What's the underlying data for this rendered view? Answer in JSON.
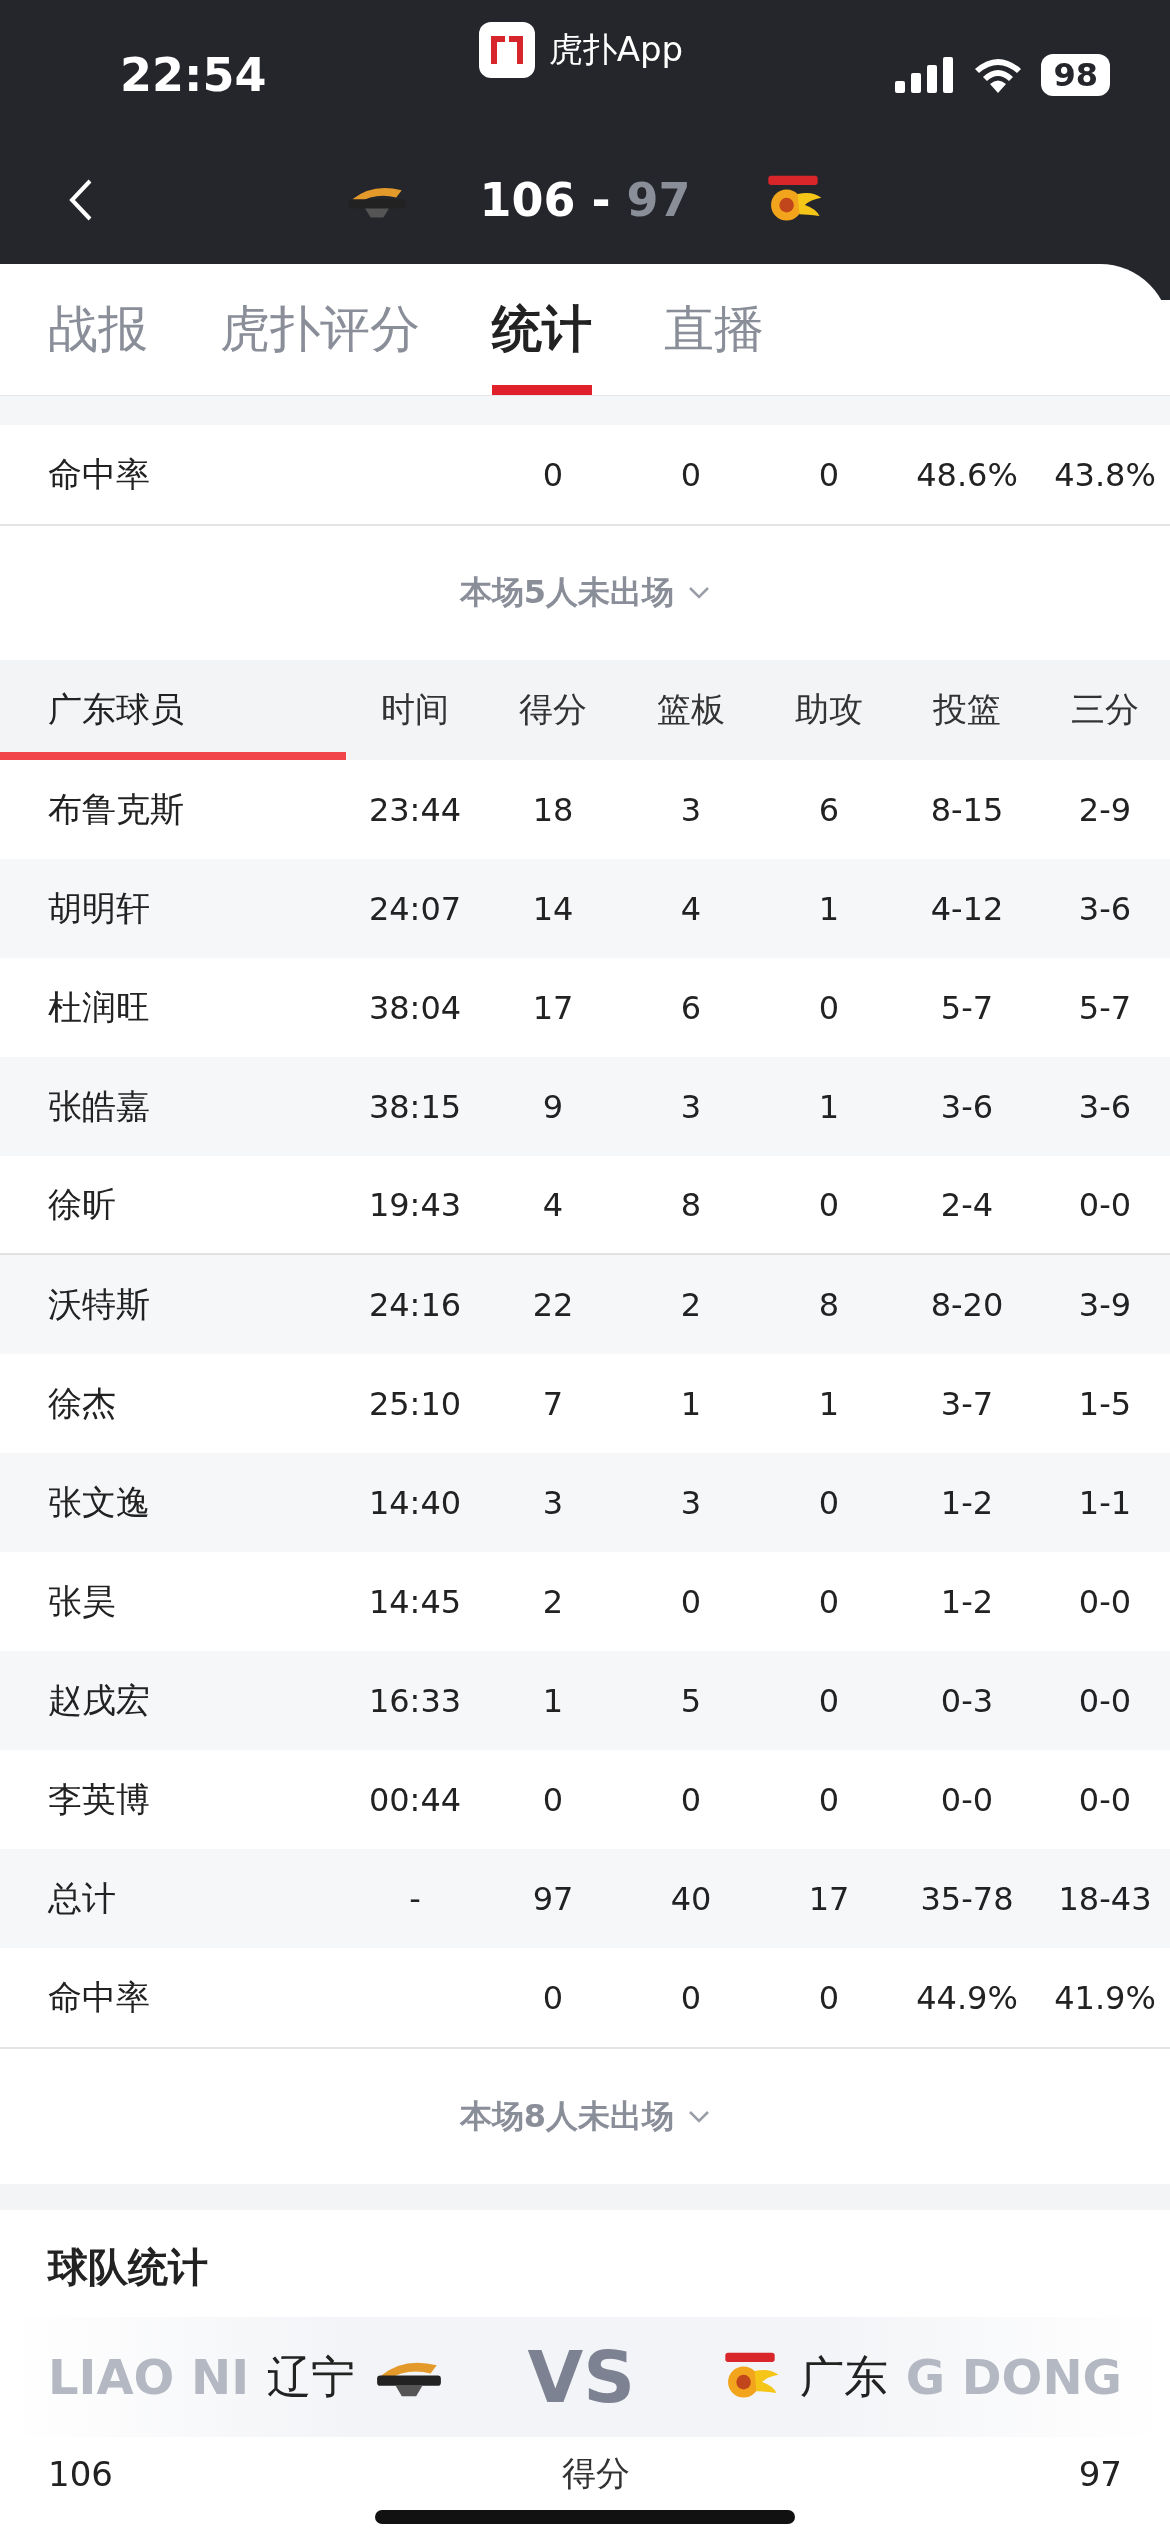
{
  "status_bar": {
    "time": "22:54",
    "back_app": "虎扑App",
    "battery": "98"
  },
  "header": {
    "home_score": "106",
    "separator": "-",
    "away_score": "97"
  },
  "tabs": [
    {
      "label": "战报",
      "selected": false
    },
    {
      "label": "虎扑评分",
      "selected": false
    },
    {
      "label": "统计",
      "selected": true
    },
    {
      "label": "直播",
      "selected": false
    }
  ],
  "prev_table": {
    "rows": [
      {
        "name": "命中率",
        "stats": [
          "0",
          "0",
          "0",
          "48.6%",
          "43.8%"
        ]
      }
    ],
    "footer": "本场5人未出场"
  },
  "table": {
    "columns": [
      "广东球员",
      "时间",
      "得分",
      "篮板",
      "助攻",
      "投篮",
      "三分"
    ],
    "row_groups": [
      [
        {
          "name": "布鲁克斯",
          "time": "23:44",
          "stats": [
            "18",
            "3",
            "6",
            "8-15",
            "2-9"
          ]
        },
        {
          "name": "胡明轩",
          "time": "24:07",
          "stats": [
            "14",
            "4",
            "1",
            "4-12",
            "3-6"
          ]
        },
        {
          "name": "杜润旺",
          "time": "38:04",
          "stats": [
            "17",
            "6",
            "0",
            "5-7",
            "5-7"
          ]
        },
        {
          "name": "张皓嘉",
          "time": "38:15",
          "stats": [
            "9",
            "3",
            "1",
            "3-6",
            "3-6"
          ]
        },
        {
          "name": "徐昕",
          "time": "19:43",
          "stats": [
            "4",
            "8",
            "0",
            "2-4",
            "0-0"
          ]
        }
      ],
      [
        {
          "name": "沃特斯",
          "time": "24:16",
          "stats": [
            "22",
            "2",
            "8",
            "8-20",
            "3-9"
          ]
        },
        {
          "name": "徐杰",
          "time": "25:10",
          "stats": [
            "7",
            "1",
            "1",
            "3-7",
            "1-5"
          ]
        },
        {
          "name": "张文逸",
          "time": "14:40",
          "stats": [
            "3",
            "3",
            "0",
            "1-2",
            "1-1"
          ]
        },
        {
          "name": "张昊",
          "time": "14:45",
          "stats": [
            "2",
            "0",
            "0",
            "1-2",
            "0-0"
          ]
        },
        {
          "name": "赵戌宏",
          "time": "16:33",
          "stats": [
            "1",
            "5",
            "0",
            "0-3",
            "0-0"
          ]
        },
        {
          "name": "李英博",
          "time": "00:44",
          "stats": [
            "0",
            "0",
            "0",
            "0-0",
            "0-0"
          ]
        },
        {
          "name": "总计",
          "time": "-",
          "stats": [
            "97",
            "40",
            "17",
            "35-78",
            "18-43"
          ]
        },
        {
          "name": "命中率",
          "stats": [
            "0",
            "0",
            "0",
            "44.9%",
            "41.9%"
          ]
        }
      ]
    ],
    "footer": "本场8人未出场"
  },
  "team_stats": {
    "title": "球队统计",
    "home": {
      "name": "辽宁",
      "watermark": "LIAO NI"
    },
    "vs": "VS",
    "away": {
      "name": "广东",
      "watermark": "G DONG"
    },
    "rows": [
      {
        "home": "106",
        "label": "得分",
        "away": "97"
      }
    ]
  }
}
